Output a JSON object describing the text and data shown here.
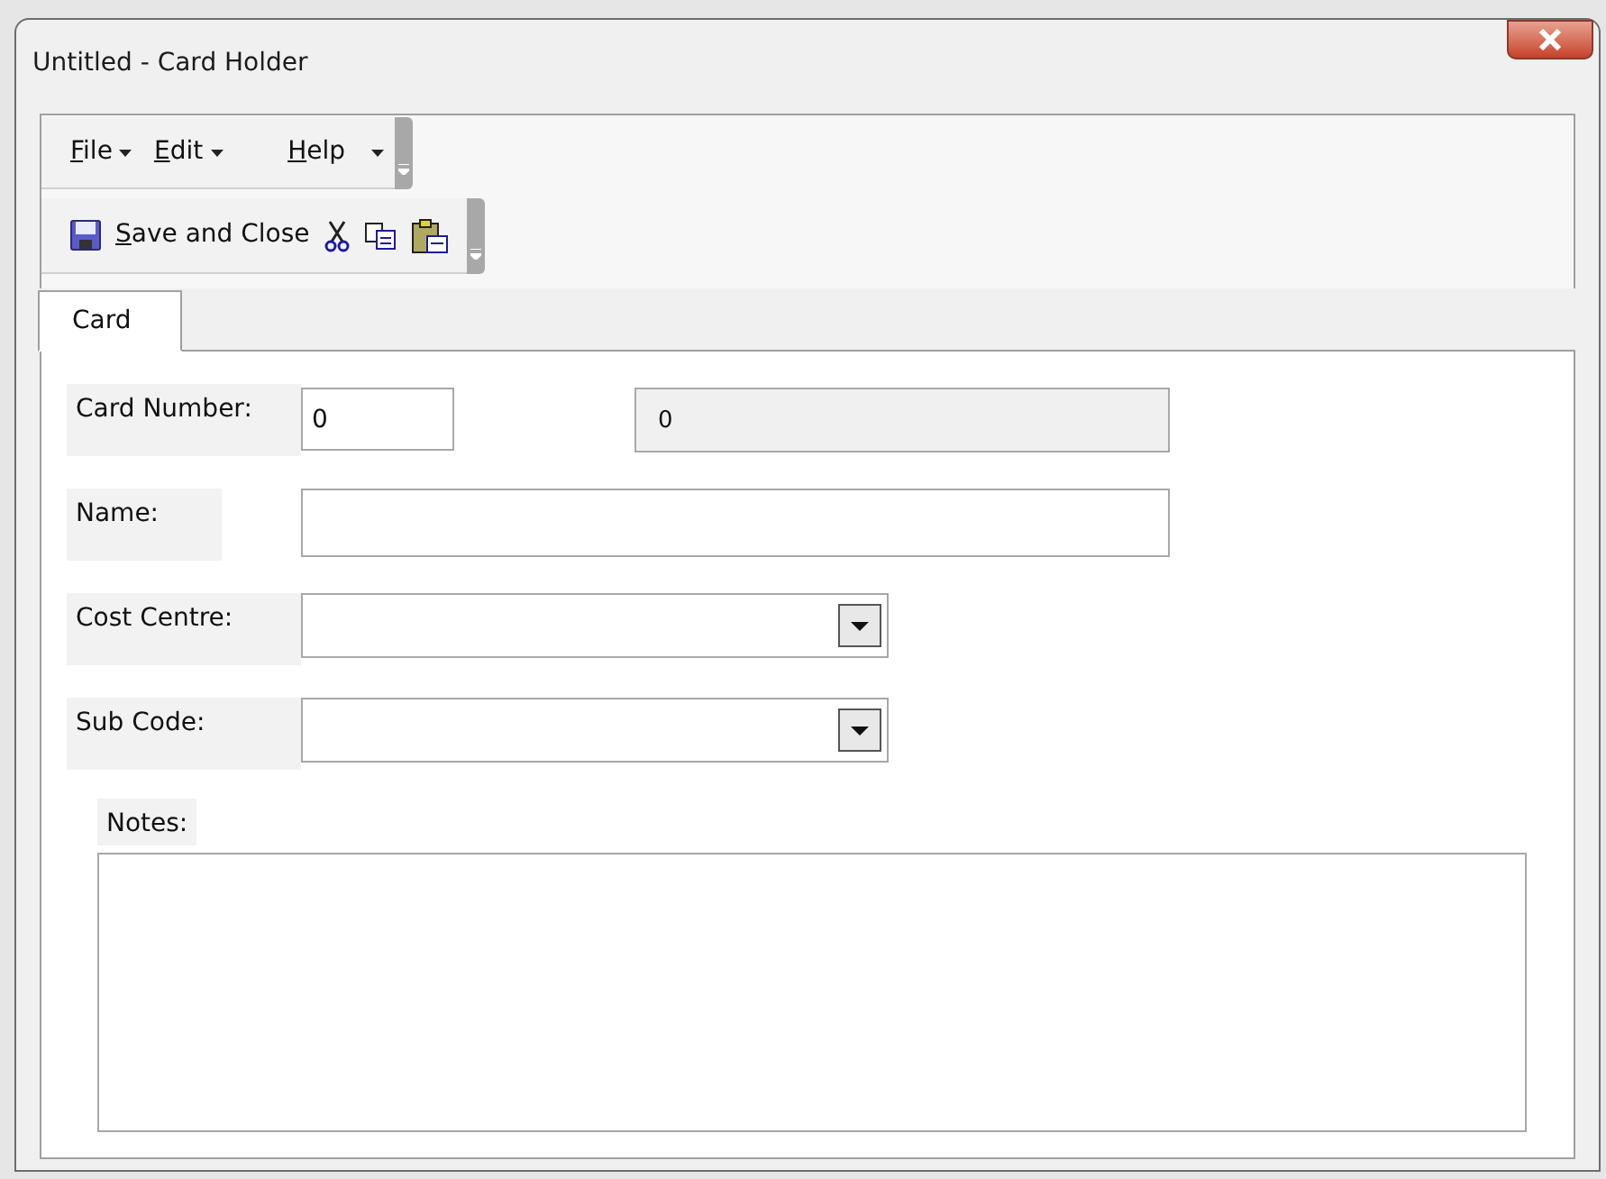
{
  "window": {
    "title": "Untitled - Card Holder"
  },
  "menu_bar": {
    "items": [
      {
        "label": "File",
        "has_dropdown": true
      },
      {
        "label": "Edit",
        "has_dropdown": true
      },
      {
        "label": "Help",
        "has_dropdown": false
      }
    ]
  },
  "toolbar": {
    "save_label": "Save and Close"
  },
  "tabs": [
    {
      "label": "Card",
      "selected": true
    }
  ],
  "form": {
    "fields": [
      {
        "kind": "text",
        "label": "Card Number:",
        "value": "0",
        "display": "0"
      },
      {
        "kind": "wide",
        "label": "Name:"
      },
      {
        "kind": "combo",
        "label": "Cost Centre:"
      },
      {
        "kind": "combo",
        "label": "Sub Code:"
      }
    ],
    "notes_label": "Notes:"
  }
}
